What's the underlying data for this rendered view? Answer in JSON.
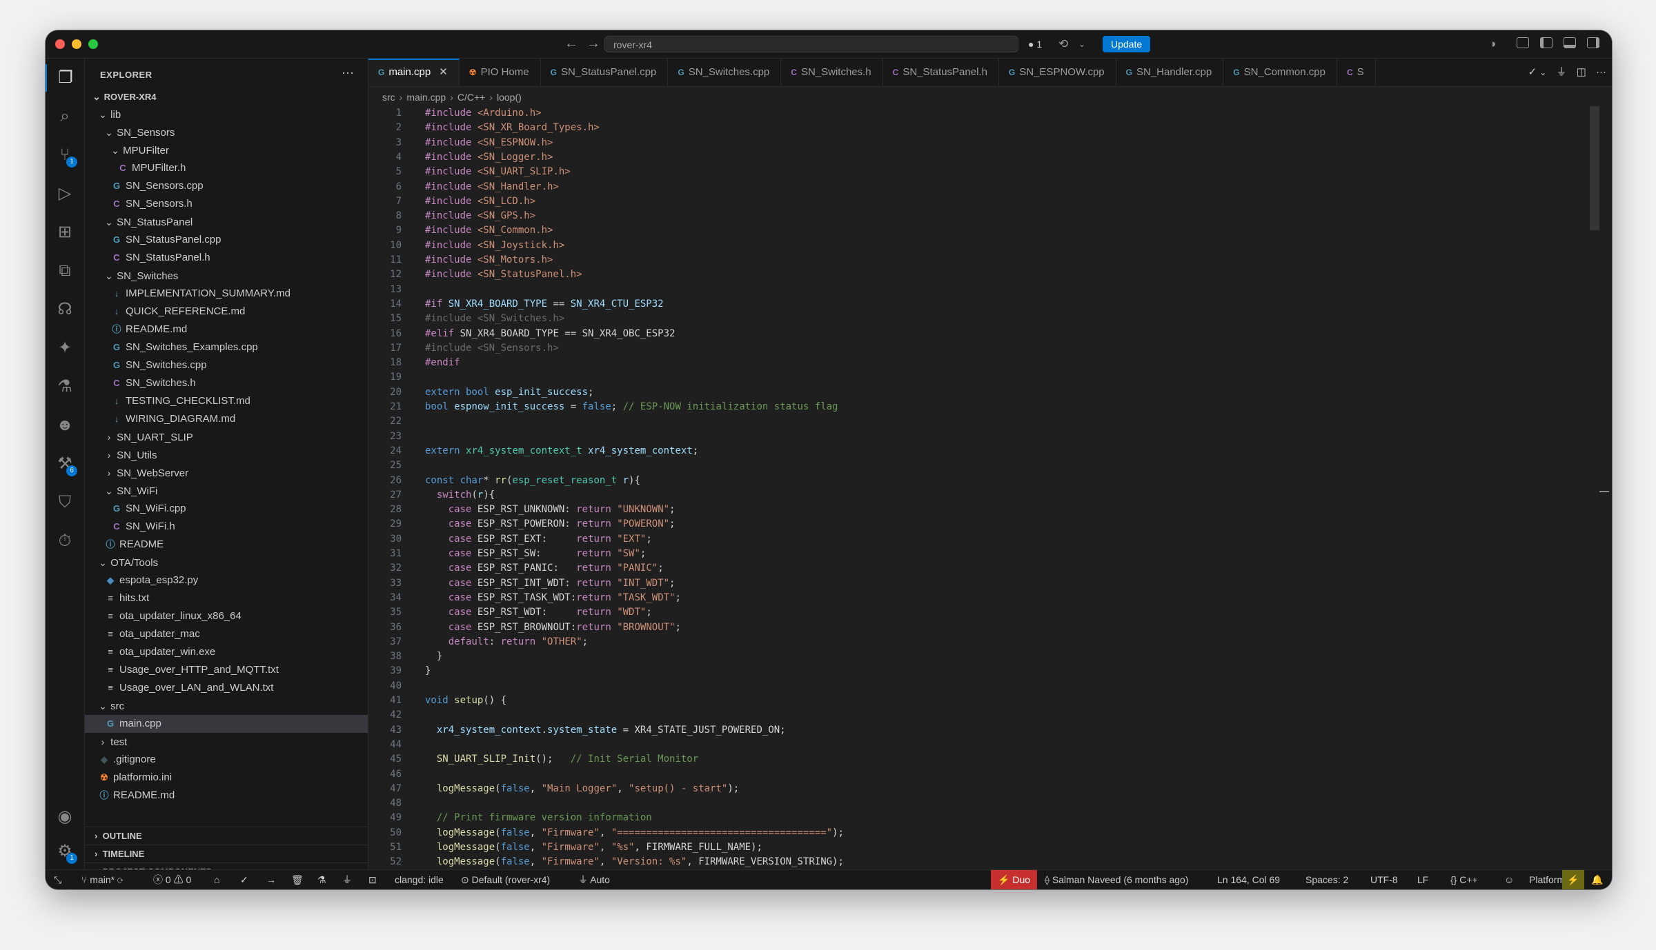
{
  "titlebar": {
    "search_text": "rover-xr4",
    "ports_count": "1",
    "update_label": "Update"
  },
  "activity_bar": {
    "items": [
      {
        "name": "explorer",
        "glyph": "❐",
        "active": true
      },
      {
        "name": "search",
        "glyph": "⌕"
      },
      {
        "name": "source-control",
        "glyph": "⑂",
        "badge": "1"
      },
      {
        "name": "run-debug",
        "glyph": "▷"
      },
      {
        "name": "extensions",
        "glyph": "⊞"
      },
      {
        "name": "remote-explorer",
        "glyph": "⧉"
      },
      {
        "name": "platformio",
        "glyph": "☊"
      },
      {
        "name": "copilot",
        "glyph": "✦"
      },
      {
        "name": "testing",
        "glyph": "⚗"
      },
      {
        "name": "alien",
        "glyph": "☻"
      },
      {
        "name": "docker",
        "glyph": "⚒",
        "badge": "6"
      },
      {
        "name": "gitlab",
        "glyph": "⛉"
      },
      {
        "name": "timer",
        "glyph": "⏱"
      }
    ],
    "account_glyph": "◉",
    "settings_glyph": "⚙",
    "settings_badge": "1"
  },
  "explorer": {
    "header": "EXPLORER",
    "more": "···",
    "tree": [
      {
        "label": "ROVER-XR4",
        "depth": 0,
        "chev": "⌄",
        "bold": true
      },
      {
        "label": "lib",
        "depth": 1,
        "chev": "⌄"
      },
      {
        "label": "SN_Sensors",
        "depth": 2,
        "chev": "⌄"
      },
      {
        "label": "MPUFilter",
        "depth": 3,
        "chev": "⌄"
      },
      {
        "label": "MPUFilter.h",
        "depth": 4,
        "icon": "C",
        "iconColor": "#a074c4"
      },
      {
        "label": "SN_Sensors.cpp",
        "depth": 3,
        "icon": "G",
        "iconColor": "#519aba"
      },
      {
        "label": "SN_Sensors.h",
        "depth": 3,
        "icon": "C",
        "iconColor": "#a074c4"
      },
      {
        "label": "SN_StatusPanel",
        "depth": 2,
        "chev": "⌄"
      },
      {
        "label": "SN_StatusPanel.cpp",
        "depth": 3,
        "icon": "G",
        "iconColor": "#519aba"
      },
      {
        "label": "SN_StatusPanel.h",
        "depth": 3,
        "icon": "C",
        "iconColor": "#a074c4"
      },
      {
        "label": "SN_Switches",
        "depth": 2,
        "chev": "⌄"
      },
      {
        "label": "IMPLEMENTATION_SUMMARY.md",
        "depth": 3,
        "icon": "↓",
        "iconColor": "#519aba"
      },
      {
        "label": "QUICK_REFERENCE.md",
        "depth": 3,
        "icon": "↓",
        "iconColor": "#519aba"
      },
      {
        "label": "README.md",
        "depth": 3,
        "icon": "ⓘ",
        "iconColor": "#519aba"
      },
      {
        "label": "SN_Switches_Examples.cpp",
        "depth": 3,
        "icon": "G",
        "iconColor": "#519aba"
      },
      {
        "label": "SN_Switches.cpp",
        "depth": 3,
        "icon": "G",
        "iconColor": "#519aba"
      },
      {
        "label": "SN_Switches.h",
        "depth": 3,
        "icon": "C",
        "iconColor": "#a074c4"
      },
      {
        "label": "TESTING_CHECKLIST.md",
        "depth": 3,
        "icon": "↓",
        "iconColor": "#519aba"
      },
      {
        "label": "WIRING_DIAGRAM.md",
        "depth": 3,
        "icon": "↓",
        "iconColor": "#519aba"
      },
      {
        "label": "SN_UART_SLIP",
        "depth": 2,
        "chev": "›"
      },
      {
        "label": "SN_Utils",
        "depth": 2,
        "chev": "›"
      },
      {
        "label": "SN_WebServer",
        "depth": 2,
        "chev": "›"
      },
      {
        "label": "SN_WiFi",
        "depth": 2,
        "chev": "⌄"
      },
      {
        "label": "SN_WiFi.cpp",
        "depth": 3,
        "icon": "G",
        "iconColor": "#519aba"
      },
      {
        "label": "SN_WiFi.h",
        "depth": 3,
        "icon": "C",
        "iconColor": "#a074c4"
      },
      {
        "label": "README",
        "depth": 2,
        "icon": "ⓘ",
        "iconColor": "#519aba"
      },
      {
        "label": "OTA/Tools",
        "depth": 1,
        "chev": "⌄"
      },
      {
        "label": "espota_esp32.py",
        "depth": 2,
        "icon": "◆",
        "iconColor": "#4b8bbe"
      },
      {
        "label": "hits.txt",
        "depth": 2,
        "icon": "≡",
        "iconColor": "#c5c5c5"
      },
      {
        "label": "ota_updater_linux_x86_64",
        "depth": 2,
        "icon": "≡",
        "iconColor": "#c5c5c5"
      },
      {
        "label": "ota_updater_mac",
        "depth": 2,
        "icon": "≡",
        "iconColor": "#c5c5c5"
      },
      {
        "label": "ota_updater_win.exe",
        "depth": 2,
        "icon": "≡",
        "iconColor": "#c5c5c5"
      },
      {
        "label": "Usage_over_HTTP_and_MQTT.txt",
        "depth": 2,
        "icon": "≡",
        "iconColor": "#c5c5c5"
      },
      {
        "label": "Usage_over_LAN_and_WLAN.txt",
        "depth": 2,
        "icon": "≡",
        "iconColor": "#c5c5c5"
      },
      {
        "label": "src",
        "depth": 1,
        "chev": "⌄"
      },
      {
        "label": "main.cpp",
        "depth": 2,
        "icon": "G",
        "iconColor": "#519aba",
        "selected": true
      },
      {
        "label": "test",
        "depth": 1,
        "chev": "›"
      },
      {
        "label": ".gitignore",
        "depth": 1,
        "icon": "◆",
        "iconColor": "#41535b"
      },
      {
        "label": "platformio.ini",
        "depth": 1,
        "icon": "☢",
        "iconColor": "#f5822a"
      },
      {
        "label": "README.md",
        "depth": 1,
        "icon": "ⓘ",
        "iconColor": "#519aba"
      }
    ],
    "sections": [
      "OUTLINE",
      "TIMELINE",
      "PROJECT COMPONENTS"
    ]
  },
  "tabs": [
    {
      "label": "main.cpp",
      "icon": "G",
      "iconColor": "#519aba",
      "active": true
    },
    {
      "label": "PIO Home",
      "icon": "☢",
      "iconColor": "#f5822a"
    },
    {
      "label": "SN_StatusPanel.cpp",
      "icon": "G",
      "iconColor": "#519aba"
    },
    {
      "label": "SN_Switches.cpp",
      "icon": "G",
      "iconColor": "#519aba"
    },
    {
      "label": "SN_Switches.h",
      "icon": "C",
      "iconColor": "#a074c4"
    },
    {
      "label": "SN_StatusPanel.h",
      "icon": "C",
      "iconColor": "#a074c4"
    },
    {
      "label": "SN_ESPNOW.cpp",
      "icon": "G",
      "iconColor": "#519aba"
    },
    {
      "label": "SN_Handler.cpp",
      "icon": "G",
      "iconColor": "#519aba"
    },
    {
      "label": "SN_Common.cpp",
      "icon": "G",
      "iconColor": "#519aba"
    },
    {
      "label": "S",
      "icon": "C",
      "iconColor": "#a074c4"
    }
  ],
  "breadcrumb": [
    "src",
    "main.cpp",
    "C/C++",
    "loop()"
  ],
  "code_lines": [
    [
      [
        "p",
        "#include "
      ],
      [
        "s",
        "<Arduino.h>"
      ]
    ],
    [
      [
        "p",
        "#include "
      ],
      [
        "s",
        "<SN_XR_Board_Types.h>"
      ]
    ],
    [
      [
        "p",
        "#include "
      ],
      [
        "s",
        "<SN_ESPNOW.h>"
      ]
    ],
    [
      [
        "p",
        "#include "
      ],
      [
        "s",
        "<SN_Logger.h>"
      ]
    ],
    [
      [
        "p",
        "#include "
      ],
      [
        "s",
        "<SN_UART_SLIP.h>"
      ]
    ],
    [
      [
        "p",
        "#include "
      ],
      [
        "s",
        "<SN_Handler.h>"
      ]
    ],
    [
      [
        "p",
        "#include "
      ],
      [
        "s",
        "<SN_LCD.h>"
      ]
    ],
    [
      [
        "p",
        "#include "
      ],
      [
        "s",
        "<SN_GPS.h>"
      ]
    ],
    [
      [
        "p",
        "#include "
      ],
      [
        "s",
        "<SN_Common.h>"
      ]
    ],
    [
      [
        "p",
        "#include "
      ],
      [
        "s",
        "<SN_Joystick.h>"
      ]
    ],
    [
      [
        "p",
        "#include "
      ],
      [
        "s",
        "<SN_Motors.h>"
      ]
    ],
    [
      [
        "p",
        "#include "
      ],
      [
        "s",
        "<SN_StatusPanel.h>"
      ]
    ],
    [],
    [
      [
        "p",
        "#if "
      ],
      [
        "v",
        "SN_XR4_BOARD_TYPE"
      ],
      [
        "m",
        " == "
      ],
      [
        "v",
        "SN_XR4_CTU_ESP32"
      ]
    ],
    [
      [
        "d",
        "#include <SN_Switches.h>"
      ]
    ],
    [
      [
        "p",
        "#elif "
      ],
      [
        "m",
        "SN_XR4_BOARD_TYPE == SN_XR4_OBC_ESP32"
      ]
    ],
    [
      [
        "d",
        "#include <SN_Sensors.h>"
      ]
    ],
    [
      [
        "p",
        "#endif"
      ]
    ],
    [],
    [
      [
        "k",
        "extern bool "
      ],
      [
        "v",
        "esp_init_success"
      ],
      [
        "m",
        ";"
      ]
    ],
    [
      [
        "k",
        "bool "
      ],
      [
        "v",
        "espnow_init_success"
      ],
      [
        "m",
        " = "
      ],
      [
        "k",
        "false"
      ],
      [
        "m",
        "; "
      ],
      [
        "c",
        "// ESP-NOW initialization status flag"
      ]
    ],
    [],
    [],
    [
      [
        "k",
        "extern "
      ],
      [
        "ty",
        "xr4_system_context_t "
      ],
      [
        "v",
        "xr4_system_context"
      ],
      [
        "m",
        ";"
      ]
    ],
    [],
    [
      [
        "k",
        "const char"
      ],
      [
        "m",
        "* "
      ],
      [
        "f",
        "rr"
      ],
      [
        "m",
        "("
      ],
      [
        "ty",
        "esp_reset_reason_t "
      ],
      [
        "v",
        "r"
      ],
      [
        "m",
        "){"
      ]
    ],
    [
      [
        "m",
        "  "
      ],
      [
        "p",
        "switch"
      ],
      [
        "m",
        "("
      ],
      [
        "v",
        "r"
      ],
      [
        "m",
        "){"
      ]
    ],
    [
      [
        "m",
        "    "
      ],
      [
        "p",
        "case "
      ],
      [
        "m",
        "ESP_RST_UNKNOWN: "
      ],
      [
        "p",
        "return "
      ],
      [
        "s",
        "\"UNKNOWN\""
      ],
      [
        "m",
        ";"
      ]
    ],
    [
      [
        "m",
        "    "
      ],
      [
        "p",
        "case "
      ],
      [
        "m",
        "ESP_RST_POWERON: "
      ],
      [
        "p",
        "return "
      ],
      [
        "s",
        "\"POWERON\""
      ],
      [
        "m",
        ";"
      ]
    ],
    [
      [
        "m",
        "    "
      ],
      [
        "p",
        "case "
      ],
      [
        "m",
        "ESP_RST_EXT:     "
      ],
      [
        "p",
        "return "
      ],
      [
        "s",
        "\"EXT\""
      ],
      [
        "m",
        ";"
      ]
    ],
    [
      [
        "m",
        "    "
      ],
      [
        "p",
        "case "
      ],
      [
        "m",
        "ESP_RST_SW:      "
      ],
      [
        "p",
        "return "
      ],
      [
        "s",
        "\"SW\""
      ],
      [
        "m",
        ";"
      ]
    ],
    [
      [
        "m",
        "    "
      ],
      [
        "p",
        "case "
      ],
      [
        "m",
        "ESP_RST_PANIC:   "
      ],
      [
        "p",
        "return "
      ],
      [
        "s",
        "\"PANIC\""
      ],
      [
        "m",
        ";"
      ]
    ],
    [
      [
        "m",
        "    "
      ],
      [
        "p",
        "case "
      ],
      [
        "m",
        "ESP_RST_INT_WDT: "
      ],
      [
        "p",
        "return "
      ],
      [
        "s",
        "\"INT_WDT\""
      ],
      [
        "m",
        ";"
      ]
    ],
    [
      [
        "m",
        "    "
      ],
      [
        "p",
        "case "
      ],
      [
        "m",
        "ESP_RST_TASK_WDT:"
      ],
      [
        "p",
        "return "
      ],
      [
        "s",
        "\"TASK_WDT\""
      ],
      [
        "m",
        ";"
      ]
    ],
    [
      [
        "m",
        "    "
      ],
      [
        "p",
        "case "
      ],
      [
        "m",
        "ESP_RST_WDT:     "
      ],
      [
        "p",
        "return "
      ],
      [
        "s",
        "\"WDT\""
      ],
      [
        "m",
        ";"
      ]
    ],
    [
      [
        "m",
        "    "
      ],
      [
        "p",
        "case "
      ],
      [
        "m",
        "ESP_RST_BROWNOUT:"
      ],
      [
        "p",
        "return "
      ],
      [
        "s",
        "\"BROWNOUT\""
      ],
      [
        "m",
        ";"
      ]
    ],
    [
      [
        "m",
        "    "
      ],
      [
        "p",
        "default"
      ],
      [
        "m",
        ": "
      ],
      [
        "p",
        "return "
      ],
      [
        "s",
        "\"OTHER\""
      ],
      [
        "m",
        ";"
      ]
    ],
    [
      [
        "m",
        "  }"
      ]
    ],
    [
      [
        "m",
        "}"
      ]
    ],
    [],
    [
      [
        "k",
        "void "
      ],
      [
        "f",
        "setup"
      ],
      [
        "m",
        "() {"
      ]
    ],
    [],
    [
      [
        "m",
        "  "
      ],
      [
        "v",
        "xr4_system_context"
      ],
      [
        "m",
        "."
      ],
      [
        "v",
        "system_state"
      ],
      [
        "m",
        " = XR4_STATE_JUST_POWERED_ON;"
      ]
    ],
    [],
    [
      [
        "m",
        "  "
      ],
      [
        "f",
        "SN_UART_SLIP_Init"
      ],
      [
        "m",
        "();   "
      ],
      [
        "c",
        "// Init Serial Monitor"
      ]
    ],
    [],
    [
      [
        "m",
        "  "
      ],
      [
        "f",
        "logMessage"
      ],
      [
        "m",
        "("
      ],
      [
        "k",
        "false"
      ],
      [
        "m",
        ", "
      ],
      [
        "s",
        "\"Main Logger\""
      ],
      [
        "m",
        ", "
      ],
      [
        "s",
        "\"setup() - start\""
      ],
      [
        "m",
        ");"
      ]
    ],
    [],
    [
      [
        "m",
        "  "
      ],
      [
        "c",
        "// Print firmware version information"
      ]
    ],
    [
      [
        "m",
        "  "
      ],
      [
        "f",
        "logMessage"
      ],
      [
        "m",
        "("
      ],
      [
        "k",
        "false"
      ],
      [
        "m",
        ", "
      ],
      [
        "s",
        "\"Firmware\""
      ],
      [
        "m",
        ", "
      ],
      [
        "s",
        "\"====================================\""
      ],
      [
        "m",
        ");"
      ]
    ],
    [
      [
        "m",
        "  "
      ],
      [
        "f",
        "logMessage"
      ],
      [
        "m",
        "("
      ],
      [
        "k",
        "false"
      ],
      [
        "m",
        ", "
      ],
      [
        "s",
        "\"Firmware\""
      ],
      [
        "m",
        ", "
      ],
      [
        "s",
        "\"%s\""
      ],
      [
        "m",
        ", FIRMWARE_FULL_NAME);"
      ]
    ],
    [
      [
        "m",
        "  "
      ],
      [
        "f",
        "logMessage"
      ],
      [
        "m",
        "("
      ],
      [
        "k",
        "false"
      ],
      [
        "m",
        ", "
      ],
      [
        "s",
        "\"Firmware\""
      ],
      [
        "m",
        ", "
      ],
      [
        "s",
        "\"Version: %s\""
      ],
      [
        "m",
        ", FIRMWARE_VERSION_STRING);"
      ]
    ]
  ],
  "statusbar": {
    "remote_glyph": "⤡",
    "branch": "main*",
    "sync_glyph": "⟳",
    "errors": "0",
    "warnings": "0",
    "clangd": "clangd: idle",
    "env": "Default (rover-xr4)",
    "auto": "Auto",
    "duo": "Duo",
    "blame": "Salman Naveed (6 months ago)",
    "position": "Ln 164, Col 69",
    "spaces": "Spaces: 2",
    "encoding": "UTF-8",
    "eol": "LF",
    "language": "C++",
    "platformio": "PlatformIO"
  },
  "colors": {
    "accent": "#0078d4",
    "duo": "#c72e2e"
  }
}
